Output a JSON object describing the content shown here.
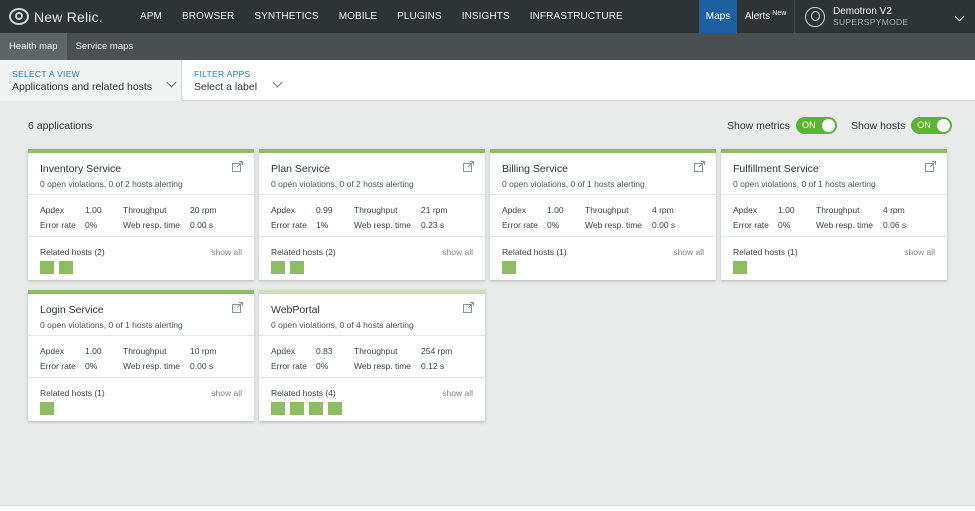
{
  "brand": {
    "name": "New Relic."
  },
  "nav": {
    "items": [
      "APM",
      "BROWSER",
      "SYNTHETICS",
      "MOBILE",
      "PLUGINS",
      "INSIGHTS",
      "INFRASTRUCTURE"
    ],
    "maps": "Maps",
    "alerts": "Alerts",
    "alerts_badge": "New"
  },
  "user": {
    "name": "Demotron V2",
    "role": "SUPERSPYMODE"
  },
  "subnav": {
    "tabs": [
      "Health map",
      "Service maps"
    ],
    "active": "Health map"
  },
  "filters": {
    "view_label": "SELECT A VIEW",
    "view_value": "Applications and related hosts",
    "apps_label": "FILTER APPS",
    "apps_value": "Select a label"
  },
  "summary": {
    "count": "6 applications",
    "show_metrics_label": "Show metrics",
    "show_metrics_state": "ON",
    "show_hosts_label": "Show hosts",
    "show_hosts_state": "ON"
  },
  "labels": {
    "apdex": "Apdex",
    "error_rate": "Error rate",
    "throughput": "Throughput",
    "web_resp": "Web resp. time",
    "show_all": "show all"
  },
  "apps": [
    {
      "name": "Inventory Service",
      "violations": "0 open violations, 0 of 2 hosts alerting",
      "apdex": "1.00",
      "error_rate": "0%",
      "throughput": "20 rpm",
      "web_resp": "0.00 s",
      "hosts_label": "Related hosts (2)",
      "host_count": 2
    },
    {
      "name": "Plan Service",
      "violations": "0 open violations, 0 of 2 hosts alerting",
      "apdex": "0.99",
      "error_rate": "1%",
      "throughput": "21 rpm",
      "web_resp": "0.23 s",
      "hosts_label": "Related hosts (2)",
      "host_count": 2
    },
    {
      "name": "Billing Service",
      "violations": "0 open violations, 0 of 1 hosts alerting",
      "apdex": "1.00",
      "error_rate": "0%",
      "throughput": "4 rpm",
      "web_resp": "0.00 s",
      "hosts_label": "Related hosts (1)",
      "host_count": 1
    },
    {
      "name": "Fulfillment Service",
      "violations": "0 open violations, 0 of 1 hosts alerting",
      "apdex": "1.00",
      "error_rate": "0%",
      "throughput": "4 rpm",
      "web_resp": "0.06 s",
      "hosts_label": "Related hosts (1)",
      "host_count": 1
    },
    {
      "name": "Login Service",
      "violations": "0 open violations, 0 of 1 hosts alerting",
      "apdex": "1.00",
      "error_rate": "0%",
      "throughput": "10 rpm",
      "web_resp": "0.00 s",
      "hosts_label": "Related hosts (1)",
      "host_count": 1
    },
    {
      "name": "WebPortal",
      "violations": "0 open violations, 0 of 4 hosts alerting",
      "apdex": "0.83",
      "error_rate": "0%",
      "throughput": "254 rpm",
      "web_resp": "0.12 s",
      "hosts_label": "Related hosts (4)",
      "host_count": 4
    }
  ],
  "colors": {
    "health_ok": "#8cbd61",
    "health_ok_light": "#c8e0b4",
    "toggle_on": "#5bb52f",
    "accent_blue": "#1d5fa0",
    "nav_bg": "#2e3333"
  },
  "icons": {
    "external_link": "external-link-icon",
    "chevron": "chevron-down-icon"
  }
}
